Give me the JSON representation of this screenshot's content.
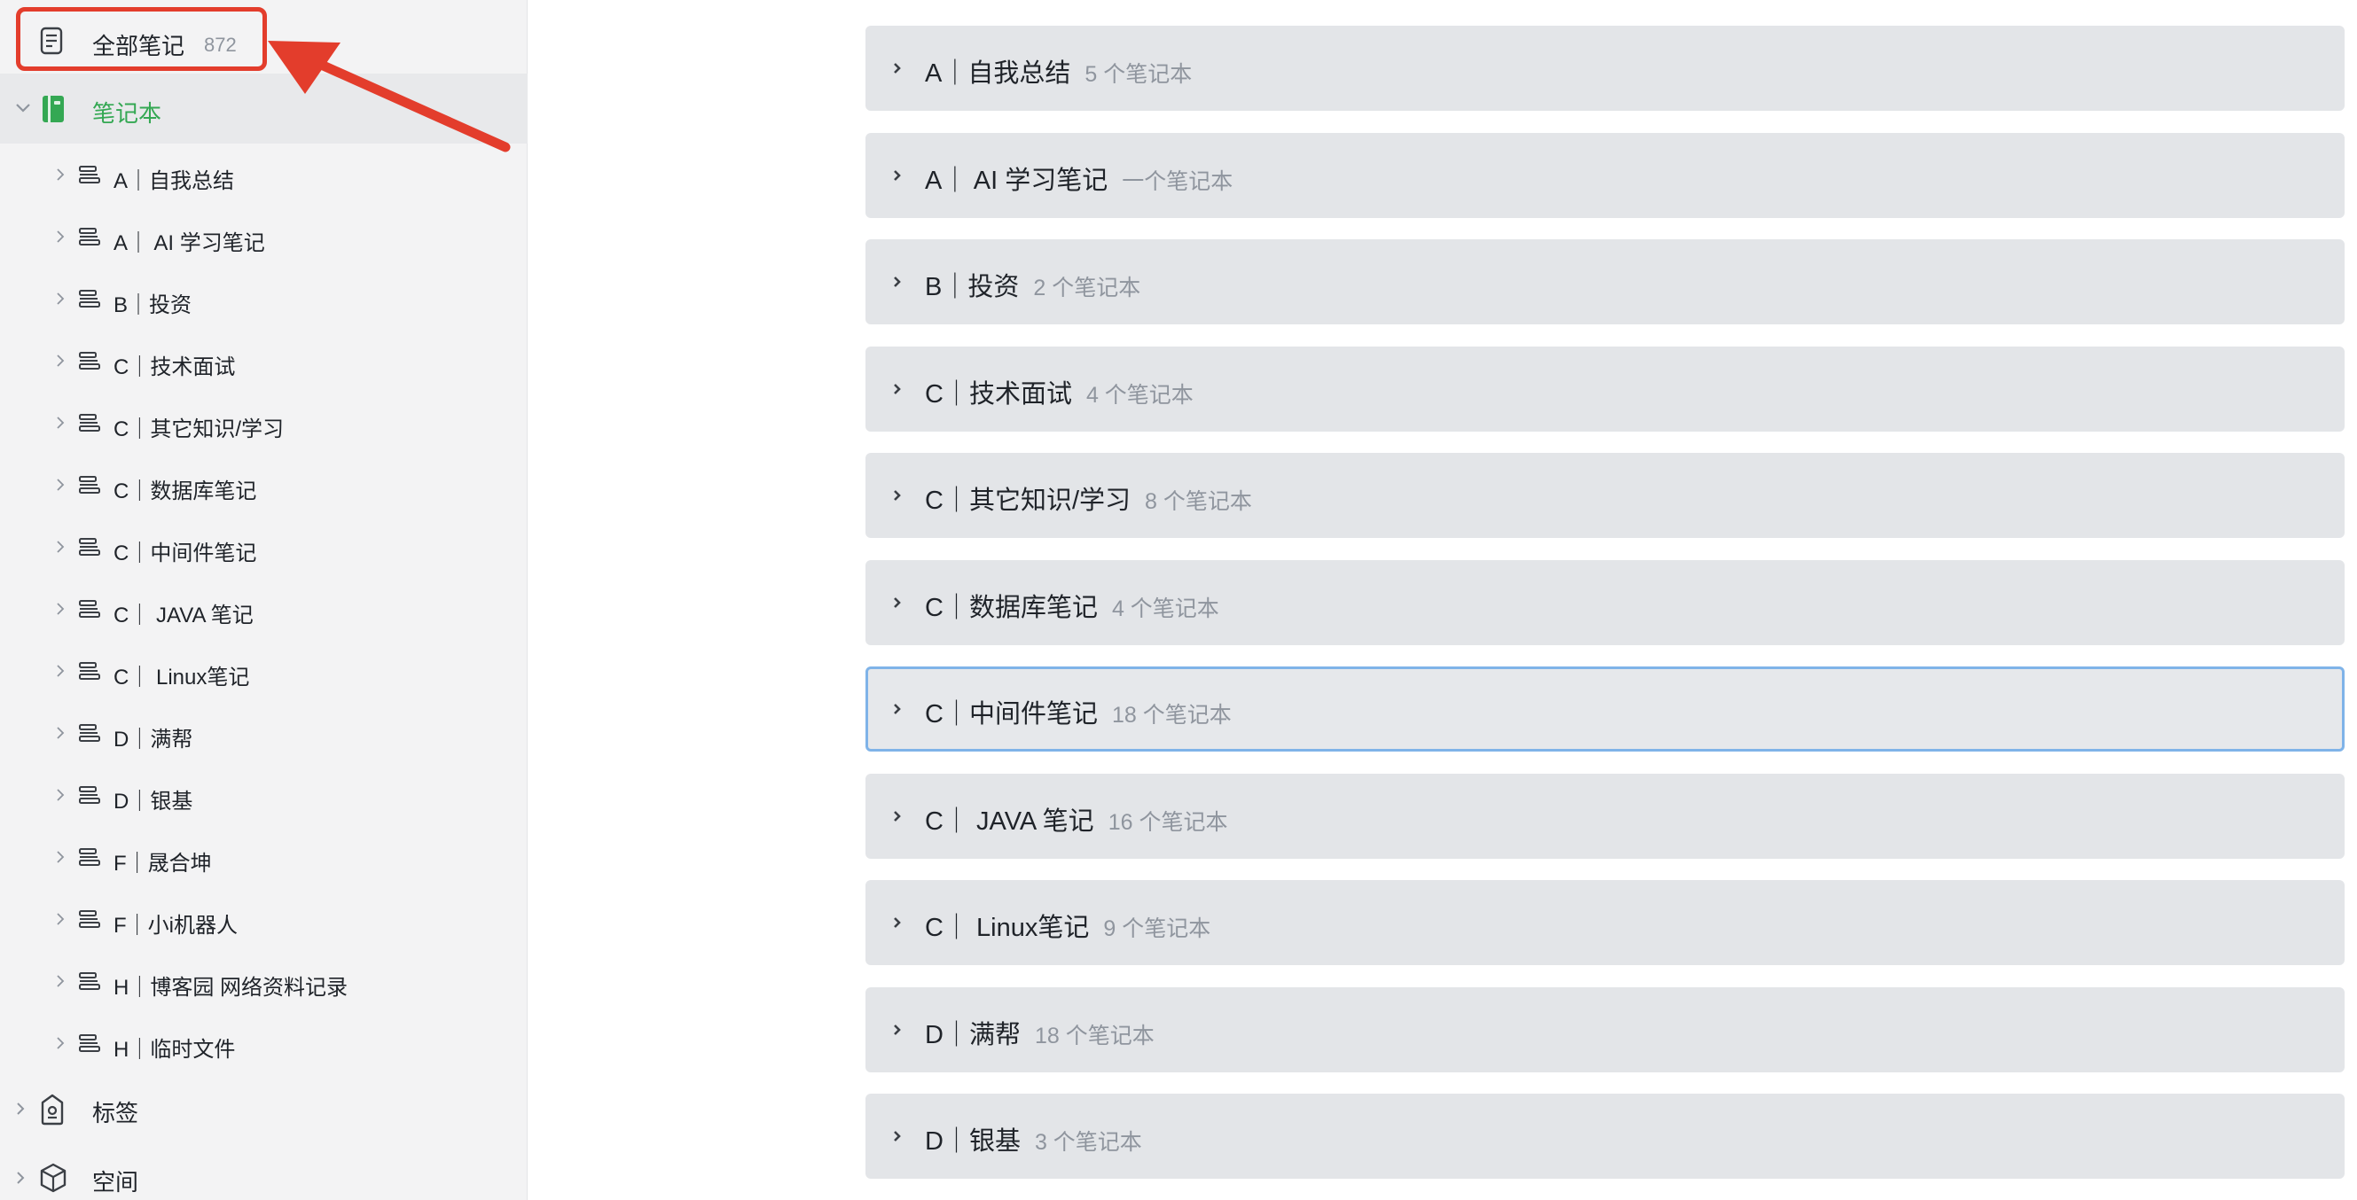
{
  "sidebar": {
    "all_notes": {
      "label": "全部笔记",
      "count": "872",
      "icon": "note-doc-icon"
    },
    "notebook_section": {
      "label": "笔记本",
      "icon": "notebook-icon",
      "accent": "#34a853"
    },
    "items": [
      {
        "label": "A｜自我总结"
      },
      {
        "label": "A｜ AI 学习笔记"
      },
      {
        "label": "B｜投资"
      },
      {
        "label": "C｜技术面试"
      },
      {
        "label": "C｜其它知识/学习"
      },
      {
        "label": "C｜数据库笔记"
      },
      {
        "label": "C｜中间件笔记"
      },
      {
        "label": "C｜ JAVA 笔记"
      },
      {
        "label": "C｜ Linux笔记"
      },
      {
        "label": "D｜满帮"
      },
      {
        "label": "D｜银基"
      },
      {
        "label": "F｜晟合坤"
      },
      {
        "label": "F｜小i机器人"
      },
      {
        "label": "H｜博客园 网络资料记录"
      },
      {
        "label": "H｜临时文件"
      }
    ],
    "tags": {
      "label": "标签",
      "icon": "tag-icon"
    },
    "spaces": {
      "label": "空间",
      "icon": "cube-icon"
    }
  },
  "main": {
    "cards": [
      {
        "title": "A｜自我总结",
        "count": "5 个笔记本"
      },
      {
        "title": "A｜ AI 学习笔记",
        "count": "一个笔记本"
      },
      {
        "title": "B｜投资",
        "count": "2 个笔记本"
      },
      {
        "title": "C｜技术面试",
        "count": "4 个笔记本"
      },
      {
        "title": "C｜其它知识/学习",
        "count": "8 个笔记本"
      },
      {
        "title": "C｜数据库笔记",
        "count": "4 个笔记本"
      },
      {
        "title": "C｜中间件笔记",
        "count": "18 个笔记本"
      },
      {
        "title": "C｜ JAVA 笔记",
        "count": "16 个笔记本"
      },
      {
        "title": "C｜ Linux笔记",
        "count": "9 个笔记本"
      },
      {
        "title": "D｜满帮",
        "count": "18 个笔记本"
      },
      {
        "title": "D｜银基",
        "count": "3 个笔记本"
      }
    ],
    "selected_index": 6
  },
  "colors": {
    "sidebar_bg": "#f3f3f4",
    "card_bg": "#e3e5e8",
    "selected_border": "#7fb3e8",
    "annotation_red": "#e33d2c"
  }
}
